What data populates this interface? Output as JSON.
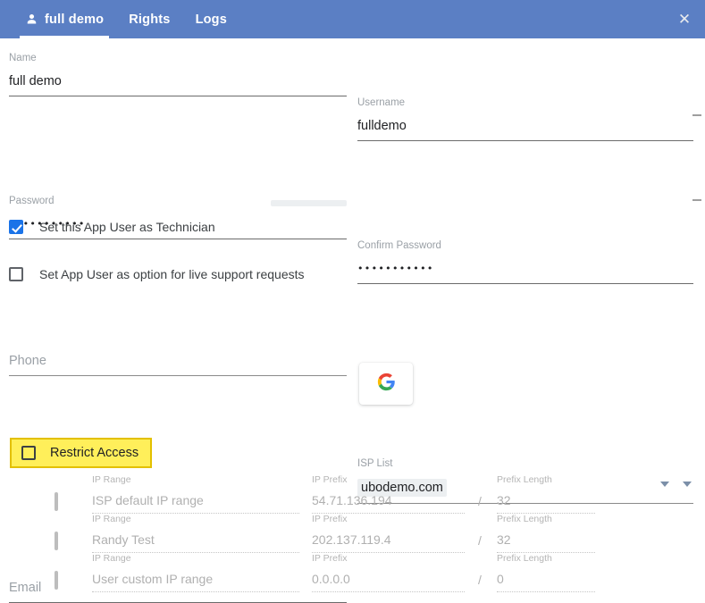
{
  "header": {
    "tabs": [
      {
        "label": "full demo",
        "icon": "person-icon",
        "active": true
      },
      {
        "label": "Rights",
        "active": false
      },
      {
        "label": "Logs",
        "active": false
      }
    ],
    "close_icon": "✕",
    "background_color": "#5b7fc4"
  },
  "form": {
    "name": {
      "label": "Name",
      "value": "full demo",
      "placeholder": ""
    },
    "username": {
      "label": "Username",
      "value": "fulldemo",
      "placeholder": ""
    },
    "password": {
      "label": "Password",
      "value": "•••••••••••",
      "placeholder": "",
      "strength_meter": "empty"
    },
    "confirm_password": {
      "label": "Confirm Password",
      "value": "•••••••••••",
      "placeholder": ""
    },
    "phone": {
      "label": "Phone",
      "value": "",
      "placeholder": "Phone"
    },
    "technician_checkbox": {
      "label": "Set this App User as Technician",
      "checked": true
    },
    "live_support_checkbox": {
      "label": "Set App User as option for live support requests",
      "checked": false
    },
    "isp_list": {
      "label": "ISP List",
      "value": "ubodemo.com",
      "arrow_icon": "chevron-down-icon"
    },
    "email": {
      "label": "Email",
      "value": "",
      "placeholder": "Email"
    },
    "google_button": {
      "icon": "google-logo-icon",
      "label": ""
    },
    "restrict_access": {
      "label": "Restrict Access",
      "checked": false,
      "highlight_color": "#ffef5a",
      "border_color": "#e3c000"
    }
  },
  "ip_table": {
    "columns": {
      "range": "IP Range",
      "prefix": "IP Prefix",
      "length": "Prefix Length"
    },
    "separator": "/",
    "rows": [
      {
        "checked": false,
        "range": "ISP default IP range",
        "prefix": "54.71.136.194",
        "length": "32"
      },
      {
        "checked": false,
        "range": "Randy Test",
        "prefix": "202.137.119.4",
        "length": "32"
      },
      {
        "checked": false,
        "range": "User custom IP range",
        "prefix": "0.0.0.0",
        "length": "0"
      }
    ]
  }
}
